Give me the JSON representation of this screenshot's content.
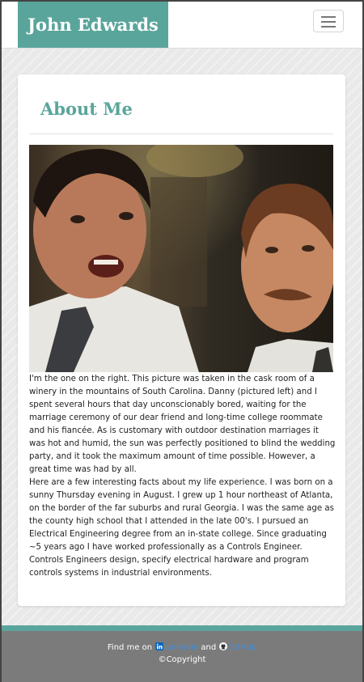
{
  "navbar": {
    "brand": "John Edwards",
    "menu_icon": "hamburger-menu-icon"
  },
  "about": {
    "title": "About Me",
    "photo_icon": "photo-image",
    "paragraphs": [
      "I'm the one on the right. This picture was taken in the cask room of a winery in the mountains of South Carolina. Danny (pictured left) and I spent several hours that day unconscionably bored, waiting for the marriage ceremony of our dear friend and long-time college roommate and his fiancée. As is customary with outdoor destination marriages it was hot and humid, the sun was perfectly positioned to blind the wedding party, and it took the maximum amount of time possible. However, a great time was had by all.",
      "Here are a few interesting facts about my life experience. I was born on a sunny Thursday evening in August. I grew up 1 hour northeast of Atlanta, on the border of the far suburbs and rural Georgia. I was the same age as the county high school that I attended in the late 00's. I pursued an Electrical Engineering degree from an in-state college. Since graduating ~5 years ago I have worked professionally as a Controls Engineer. Controls Engineers design, specify electrical hardware and program controls systems in industrial environments."
    ]
  },
  "footer": {
    "find_me": "Find me on",
    "linkedin_label": "LinkedIn",
    "and": "and",
    "github_label": "GitHub",
    "copyright": "©Copyright",
    "linkedin_icon": "linkedin-icon",
    "github_icon": "github-icon"
  },
  "colors": {
    "accent": "#5aa59b",
    "footer_bg": "#7b7b7b",
    "link": "#3b8fe0"
  }
}
